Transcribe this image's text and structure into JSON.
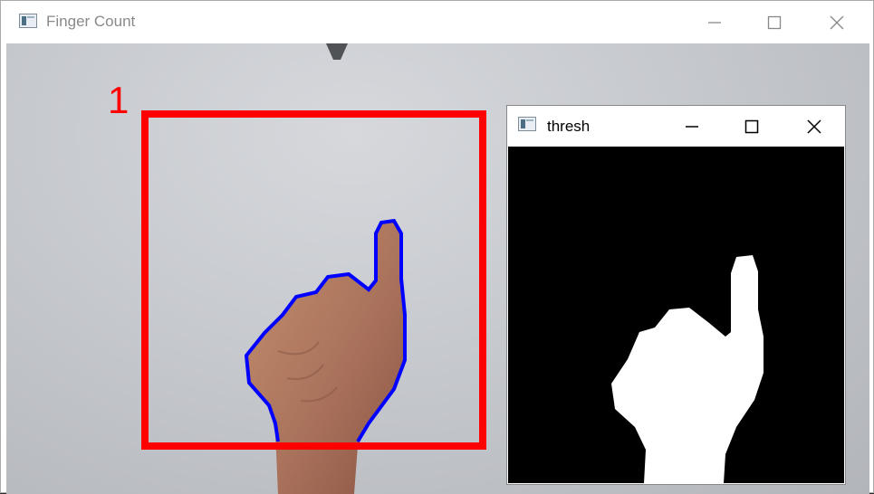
{
  "main_window": {
    "title": "Finger Count"
  },
  "overlay": {
    "count": "1"
  },
  "thresh_window": {
    "title": "thresh"
  },
  "colors": {
    "roi_box": "#ff0000",
    "contour": "#0000ff",
    "mask": "#ffffff"
  },
  "icons": {
    "minimize": "minimize-icon",
    "maximize": "maximize-icon",
    "close": "close-icon"
  }
}
